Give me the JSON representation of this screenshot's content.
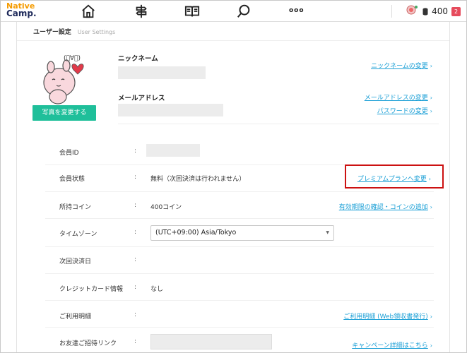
{
  "app": {
    "logo_line1": "Native",
    "logo_line2": "Camp.",
    "coin_count": "400",
    "notification_badge": "2"
  },
  "nav": {
    "icons": [
      "home-icon",
      "signpost-icon",
      "book-icon",
      "search-icon",
      "more-icon"
    ],
    "more_label": "ooo"
  },
  "page": {
    "section_title": "ユーザー設定",
    "section_subtitle": "User Settings"
  },
  "profile": {
    "photo_button": "写真を変更する",
    "nickname_label": "ニックネーム",
    "nickname_link": "ニックネームの変更",
    "email_label": "メールアドレス",
    "email_link": "メールアドレスの変更",
    "password_link": "パスワードの変更"
  },
  "rows": {
    "member_id": {
      "label": "会員ID",
      "colon": ":"
    },
    "member_status": {
      "label": "会員状態",
      "colon": ":",
      "value": "無料（次回決済は行われません）",
      "link": "プレミアムプランへ変更"
    },
    "coins": {
      "label": "所持コイン",
      "colon": ":",
      "value": "400コイン",
      "link": "有効期限の確認・コインの追加"
    },
    "timezone": {
      "label": "タイムゾーン",
      "colon": ":",
      "value": "(UTC+09:00) Asia/Tokyo"
    },
    "next_billing": {
      "label": "次回決済日",
      "colon": ":"
    },
    "credit_card": {
      "label": "クレジットカード情報",
      "colon": ":",
      "value": "なし"
    },
    "usage": {
      "label": "ご利用明細",
      "colon": ":",
      "link": "ご利用明細 (Web領収書発行)"
    },
    "referral": {
      "label": "お友達ご招待リンク",
      "colon": ":",
      "link": "キャンペーン詳細はこちら"
    }
  },
  "colors": {
    "accent_green": "#1fbf9a",
    "link_blue": "#1a9fd6",
    "highlight_red": "#cc1111",
    "logo_orange": "#f59b00"
  }
}
